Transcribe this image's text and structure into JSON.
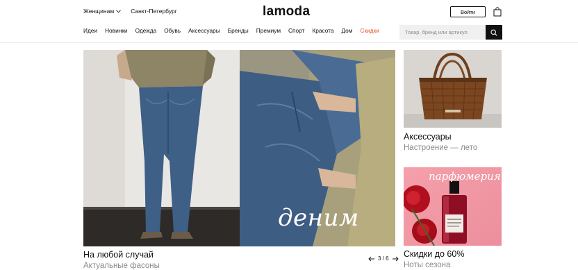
{
  "header": {
    "gender_label": "Женщинам",
    "city_label": "Санкт-Петербург",
    "logo": "lamoda",
    "login_label": "Войти"
  },
  "nav": [
    {
      "label": "Идеи"
    },
    {
      "label": "Новинки"
    },
    {
      "label": "Одежда"
    },
    {
      "label": "Обувь"
    },
    {
      "label": "Аксессуары"
    },
    {
      "label": "Бренды"
    },
    {
      "label": "Премиум"
    },
    {
      "label": "Спорт"
    },
    {
      "label": "Красота"
    },
    {
      "label": "Дом"
    },
    {
      "label": "Скидки",
      "accent": "#e8502c"
    }
  ],
  "search": {
    "placeholder": "Товар, бренд или артикул"
  },
  "banner": {
    "word": "деним",
    "title": "На любой случай",
    "subtitle": "Актуальные фасоны",
    "pager": "3 / 6"
  },
  "cards": [
    {
      "title": "Аксессуары",
      "subtitle": "Настроение — лето"
    },
    {
      "label": "парфюмерия",
      "title": "Скидки до 60%",
      "subtitle": "Ноты сезона"
    }
  ],
  "colors": {
    "accent": "#e8502c",
    "text": "#111111",
    "muted": "#8a8a8a"
  }
}
